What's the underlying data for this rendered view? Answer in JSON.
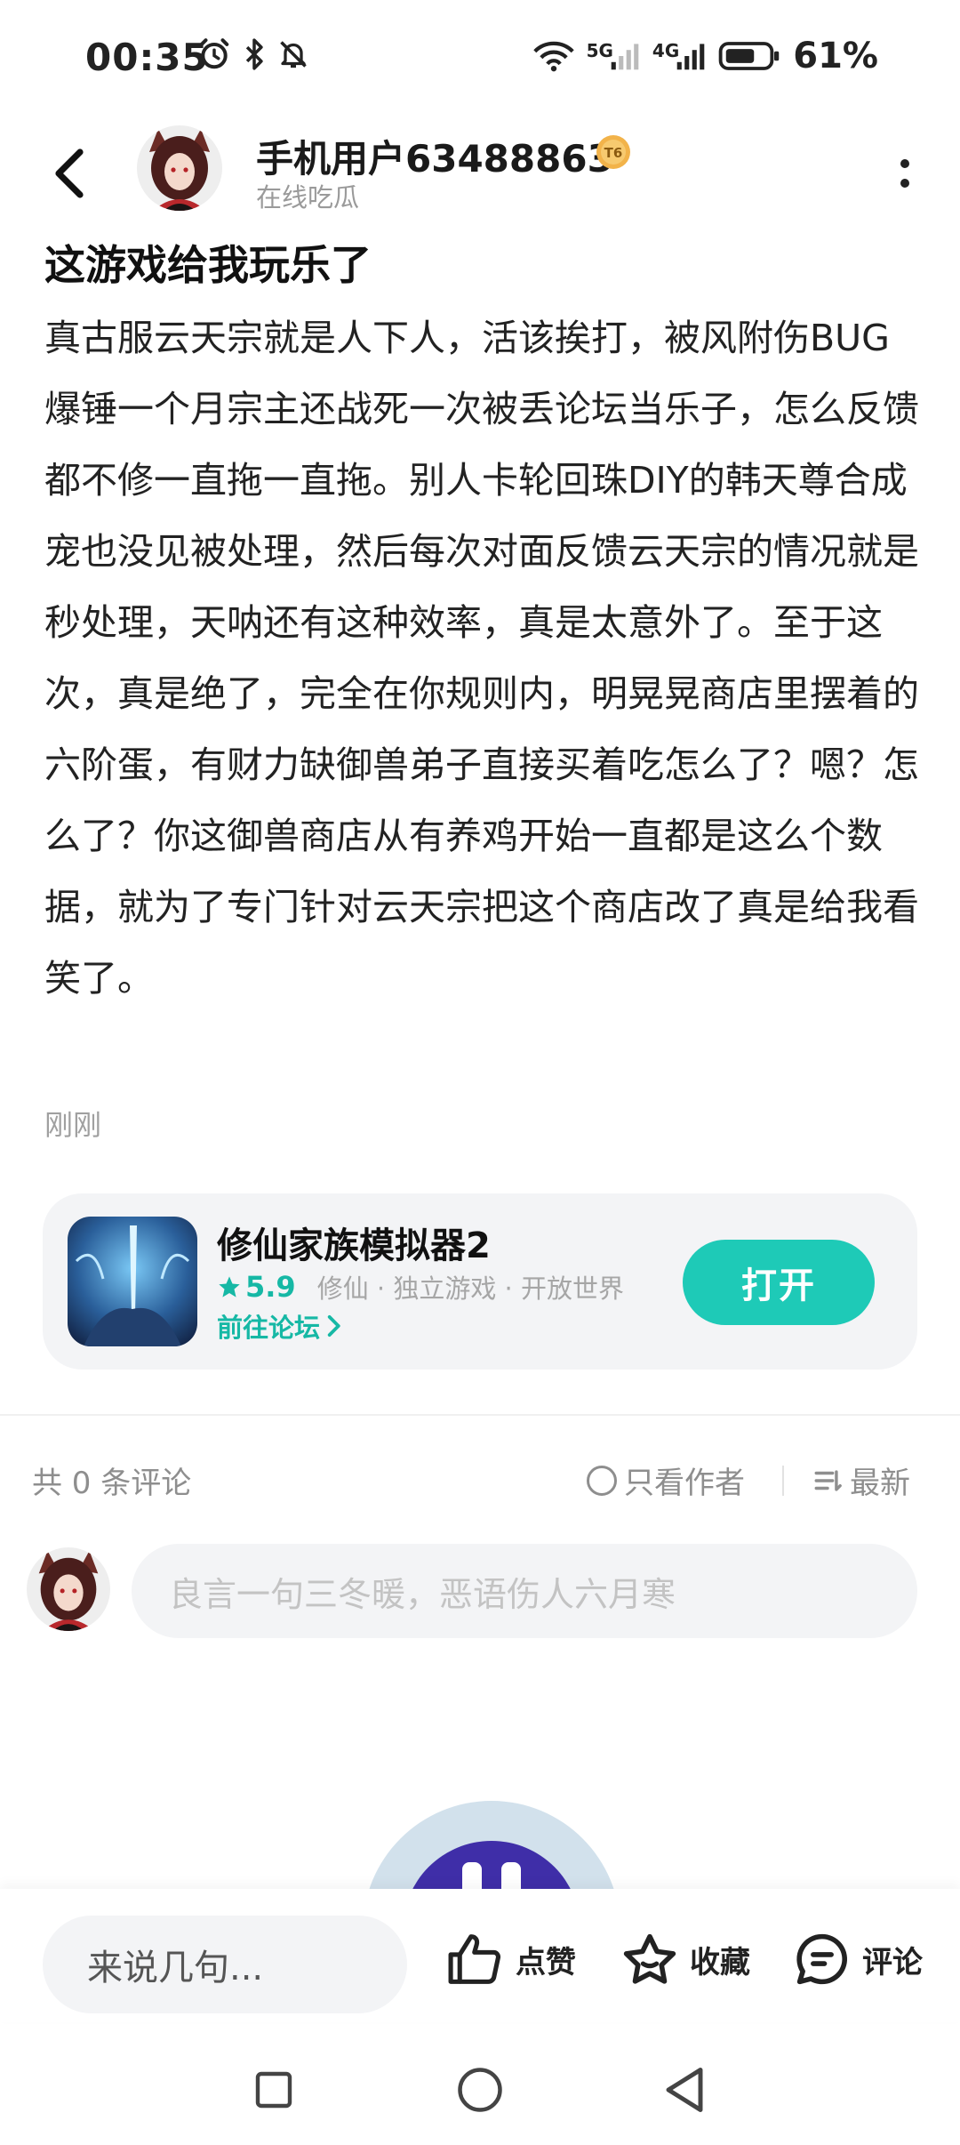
{
  "status_bar": {
    "time": "00:35",
    "battery_text": "61%",
    "net_5g": "5G",
    "net_4g": "4G",
    "icons": [
      "alarm-icon",
      "bluetooth-icon",
      "mute-icon",
      "wifi-icon",
      "signal-icon",
      "battery-icon"
    ]
  },
  "header": {
    "author_name": "手机用户63488863",
    "author_status": "在线吃瓜",
    "badge_text": "T6"
  },
  "post": {
    "title": "这游戏给我玩乐了",
    "body": "真古服云天宗就是人下人，活该挨打，被风附伤BUG爆锤一个月宗主还战死一次被丢论坛当乐子，怎么反馈都不修一直拖一直拖。别人卡轮回珠DIY的韩天尊合成宠也没见被处理，然后每次对面反馈云天宗的情况就是秒处理，天呐还有这种效率，真是太意外了。至于这次，真是绝了，完全在你规则内，明晃晃商店里摆着的六阶蛋，有财力缺御兽弟子直接买着吃怎么了？嗯？怎么了？你这御兽商店从有养鸡开始一直都是这么个数据，就为了专门针对云天宗把这个商店改了真是给我看笑了。",
    "time": "刚刚"
  },
  "game_card": {
    "name": "修仙家族模拟器2",
    "rating": "5.9",
    "tags": "修仙 · 独立游戏 · 开放世界",
    "forum_link": "前往论坛",
    "open_label": "打开"
  },
  "comments": {
    "count_label": "共 0 条评论",
    "only_author_label": "只看作者",
    "sort_label": "最新",
    "input_placeholder": "良言一句三冬暖，恶语伤人六月寒"
  },
  "bottom_bar": {
    "say_placeholder": "来说几句...",
    "like_label": "点赞",
    "favorite_label": "收藏",
    "comment_label": "评论"
  },
  "colors": {
    "accent": "#1ecab7",
    "accent_text": "#16b8a5",
    "muted": "#8e8e8e",
    "card_bg": "#f3f4f6"
  }
}
